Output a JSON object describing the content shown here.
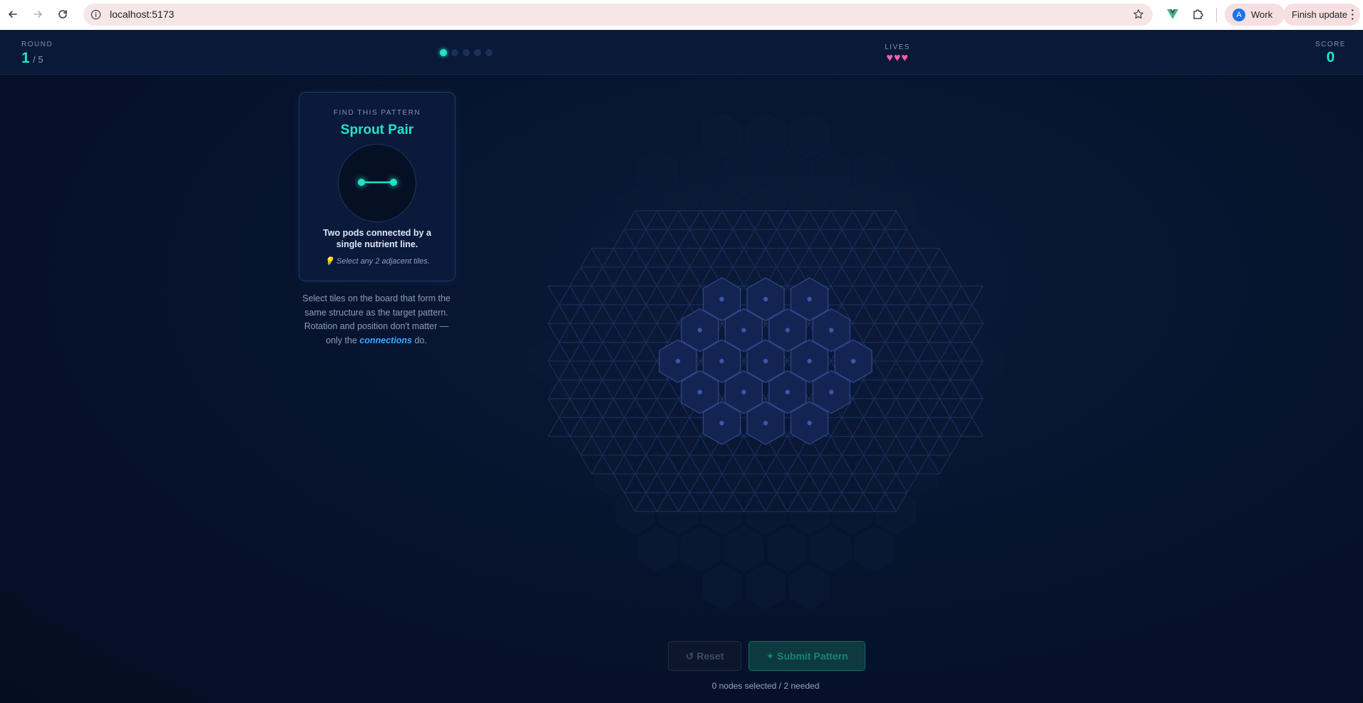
{
  "browser": {
    "url": "localhost:5173",
    "profile_initial": "A",
    "profile_label": "Work",
    "update_label": "Finish update"
  },
  "header": {
    "round_label": "ROUND",
    "round_current": "1",
    "round_total": "/ 5",
    "progress_total": 5,
    "progress_current": 1,
    "lives_label": "LIVES",
    "lives_hearts": "♥♥♥",
    "lives_count": 3,
    "score_label": "SCORE",
    "score_value": "0"
  },
  "pattern_card": {
    "caption": "FIND THIS PATTERN",
    "name": "Sprout Pair",
    "description": "Two pods connected by a single nutrient line.",
    "hint": "💡 Select any 2 adjacent tiles."
  },
  "instructions": {
    "before": "Select tiles on the board that form the same structure as the target pattern. Rotation and position don't matter — only the ",
    "emphasis": "connections",
    "after": " do."
  },
  "board": {
    "active_rows": [
      3,
      4,
      5,
      4,
      3
    ],
    "selected_count": 0
  },
  "actions": {
    "reset_label": "↺ Reset",
    "submit_label": "✦ Submit Pattern"
  },
  "status_text": "0 nodes selected / 2 needed",
  "colors": {
    "accent": "#22e3c6",
    "heart": "#ff5fa8",
    "link": "#3aa8ff",
    "background": "#07142e"
  }
}
